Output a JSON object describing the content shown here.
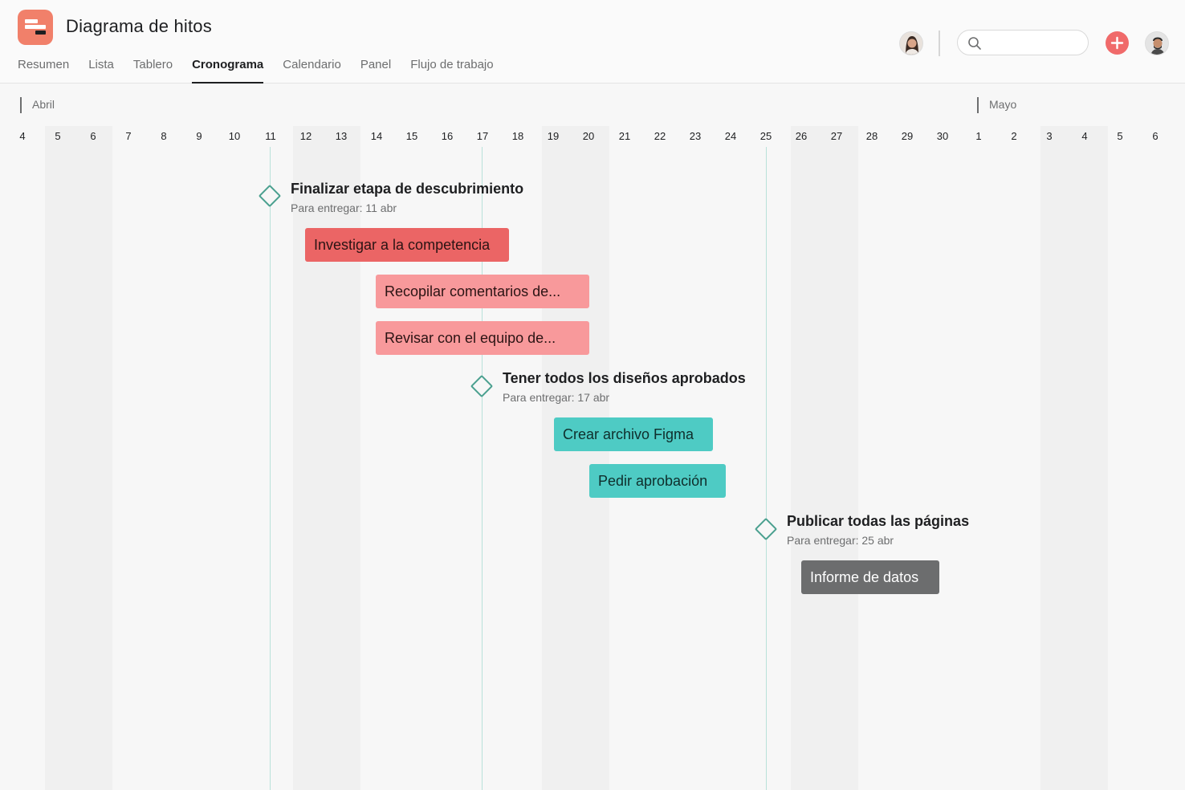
{
  "header": {
    "project_title": "Diagrama de hitos",
    "search": {
      "value": "",
      "placeholder": ""
    },
    "tabs": [
      {
        "label": "Resumen"
      },
      {
        "label": "Lista"
      },
      {
        "label": "Tablero"
      },
      {
        "label": "Cronograma",
        "active": true
      },
      {
        "label": "Calendario"
      },
      {
        "label": "Panel"
      },
      {
        "label": "Flujo de trabajo"
      }
    ],
    "icons": [
      "app-logo-icon",
      "avatar",
      "search-icon",
      "plus-icon",
      "avatar"
    ]
  },
  "timeline": {
    "months": [
      {
        "label": "Abril"
      },
      {
        "label": "Mayo"
      }
    ],
    "days": [
      "4",
      "5",
      "6",
      "7",
      "8",
      "9",
      "10",
      "11",
      "12",
      "13",
      "14",
      "15",
      "16",
      "17",
      "18",
      "19",
      "20",
      "21",
      "22",
      "23",
      "24",
      "25",
      "26",
      "27",
      "28",
      "29",
      "30",
      "1",
      "2",
      "3",
      "4",
      "5",
      "6"
    ],
    "milestones": [
      {
        "title": "Finalizar etapa de descubrimiento",
        "due": "Para entregar: 11 abr"
      },
      {
        "title": "Tener todos los diseños aprobados",
        "due": "Para entregar: 17 abr"
      },
      {
        "title": "Publicar todas las páginas",
        "due": "Para entregar: 25 abr"
      }
    ],
    "tasks": [
      {
        "label": "Investigar a la competencia",
        "color": "#eb6565"
      },
      {
        "label": "Recopilar comentarios de...",
        "color": "#f8999b"
      },
      {
        "label": "Revisar con el equipo de...",
        "color": "#f8999b"
      },
      {
        "label": "Crear archivo Figma",
        "color": "#4ecbc4"
      },
      {
        "label": "Pedir aprobación",
        "color": "#4ecbc4"
      },
      {
        "label": "Informe de datos",
        "color": "#6c6d6e"
      }
    ]
  },
  "colors": {
    "accent": "#f06a6a",
    "milestone": "#4aa08f",
    "logo": "#f1806a"
  }
}
